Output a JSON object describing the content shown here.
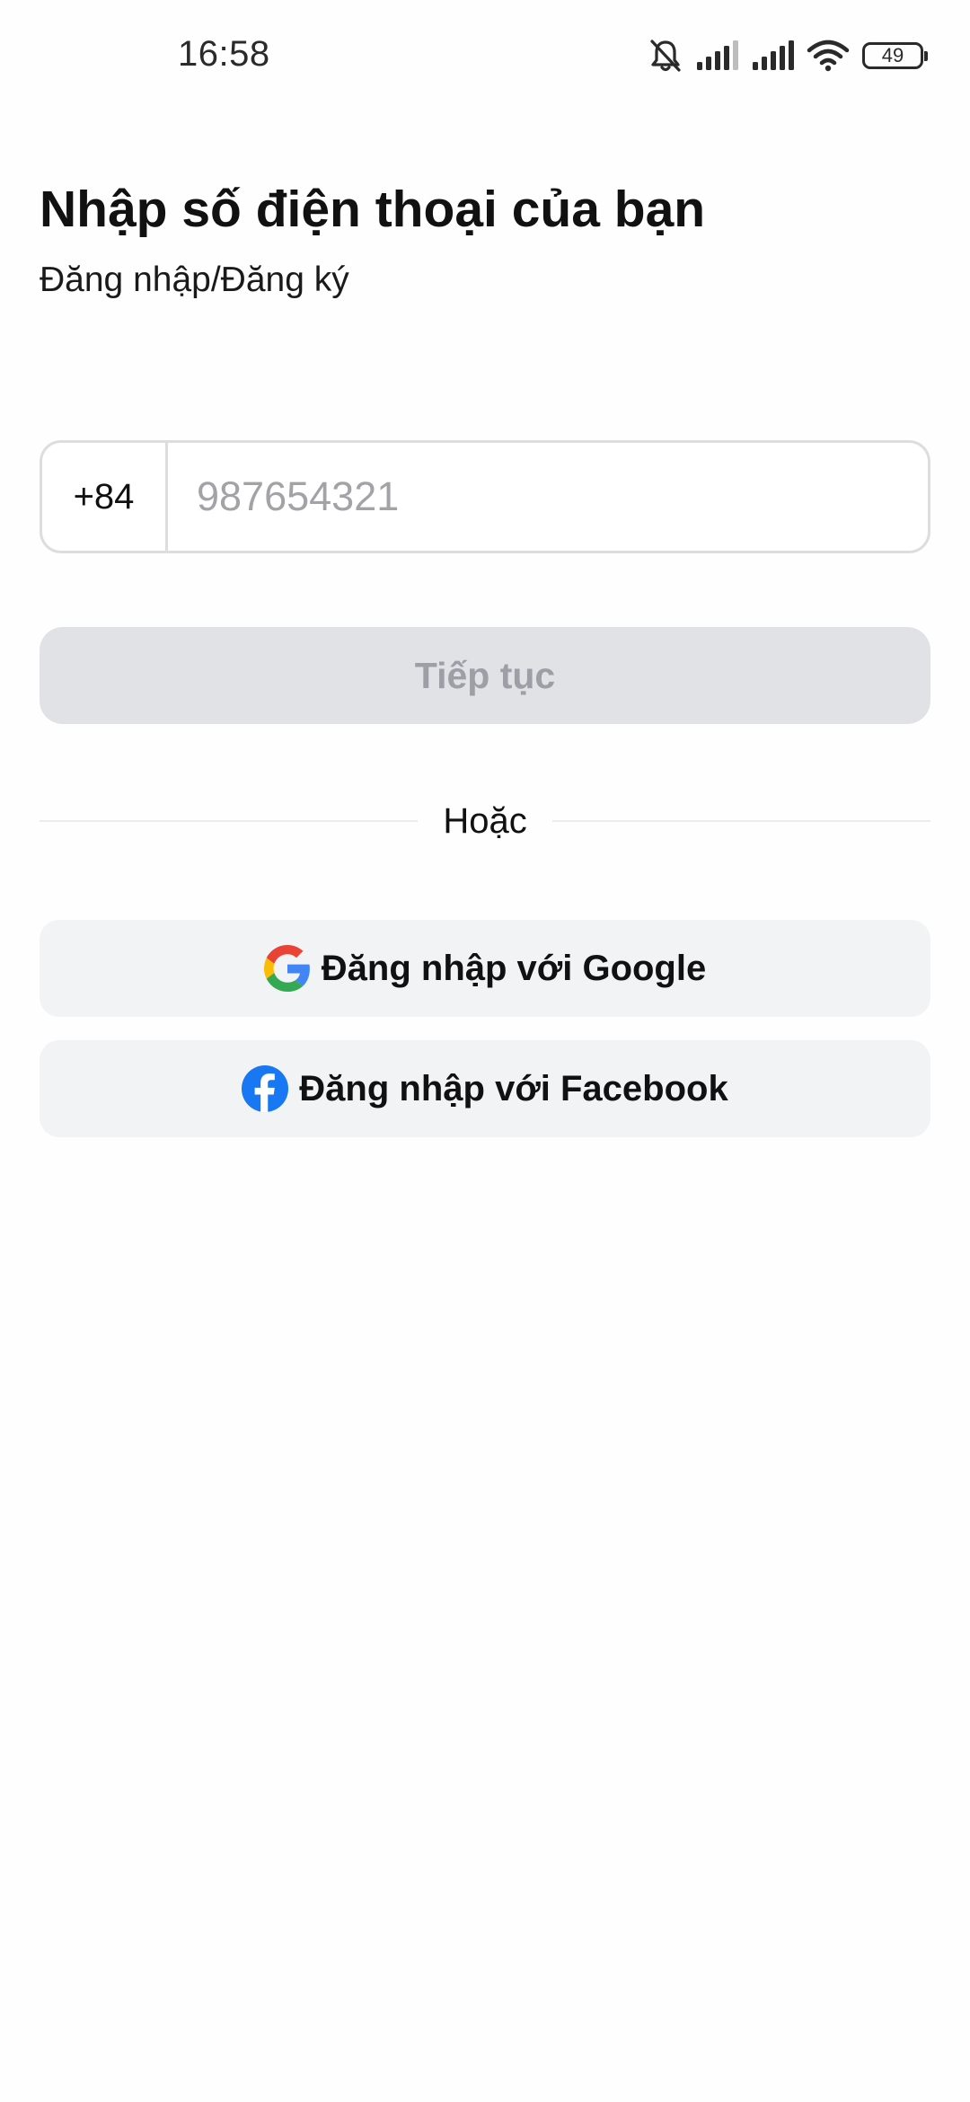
{
  "status_bar": {
    "time": "16:58",
    "battery_level": "49",
    "icons": [
      "bell-muted-icon",
      "cellular-signal-icon",
      "cellular-signal-icon",
      "wifi-icon",
      "battery-icon"
    ]
  },
  "header": {
    "title": "Nhập số điện thoại của bạn",
    "subtitle": "Đăng nhập/Đăng ký"
  },
  "phone_form": {
    "country_code": "+84",
    "phone_placeholder": "987654321",
    "phone_value": ""
  },
  "continue_button": {
    "label": "Tiếp tục",
    "enabled": false
  },
  "divider": {
    "label": "Hoặc"
  },
  "social_login": {
    "google_label": "Đăng nhập với Google",
    "facebook_label": "Đăng nhập với Facebook"
  },
  "colors": {
    "disabled_button_bg": "#e1e2e6",
    "disabled_button_text": "#9d9ea6",
    "social_button_bg": "#f2f3f5",
    "facebook_blue": "#1877f2",
    "google_blue": "#4285f4",
    "google_red": "#ea4335",
    "google_yellow": "#fbbc05",
    "google_green": "#34a853"
  }
}
